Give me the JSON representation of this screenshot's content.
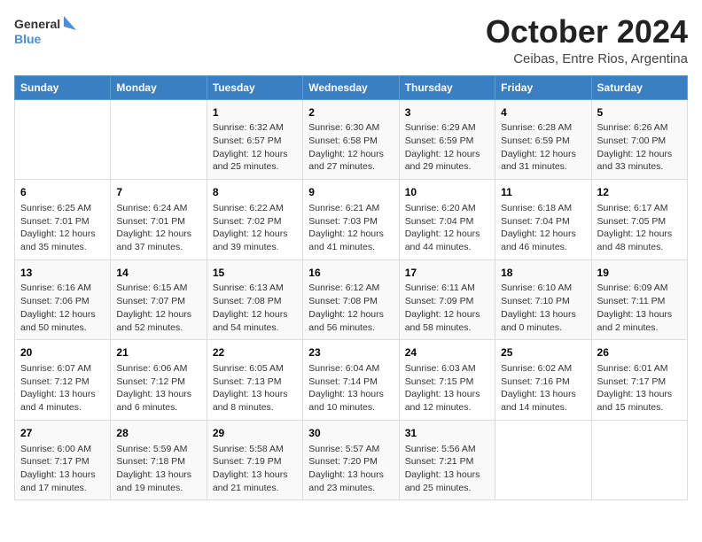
{
  "logo": {
    "general": "General",
    "blue": "Blue"
  },
  "title": "October 2024",
  "subtitle": "Ceibas, Entre Rios, Argentina",
  "days_header": [
    "Sunday",
    "Monday",
    "Tuesday",
    "Wednesday",
    "Thursday",
    "Friday",
    "Saturday"
  ],
  "weeks": [
    [
      {
        "day": "",
        "content": ""
      },
      {
        "day": "",
        "content": ""
      },
      {
        "day": "1",
        "content": "Sunrise: 6:32 AM\nSunset: 6:57 PM\nDaylight: 12 hours\nand 25 minutes."
      },
      {
        "day": "2",
        "content": "Sunrise: 6:30 AM\nSunset: 6:58 PM\nDaylight: 12 hours\nand 27 minutes."
      },
      {
        "day": "3",
        "content": "Sunrise: 6:29 AM\nSunset: 6:59 PM\nDaylight: 12 hours\nand 29 minutes."
      },
      {
        "day": "4",
        "content": "Sunrise: 6:28 AM\nSunset: 6:59 PM\nDaylight: 12 hours\nand 31 minutes."
      },
      {
        "day": "5",
        "content": "Sunrise: 6:26 AM\nSunset: 7:00 PM\nDaylight: 12 hours\nand 33 minutes."
      }
    ],
    [
      {
        "day": "6",
        "content": "Sunrise: 6:25 AM\nSunset: 7:01 PM\nDaylight: 12 hours\nand 35 minutes."
      },
      {
        "day": "7",
        "content": "Sunrise: 6:24 AM\nSunset: 7:01 PM\nDaylight: 12 hours\nand 37 minutes."
      },
      {
        "day": "8",
        "content": "Sunrise: 6:22 AM\nSunset: 7:02 PM\nDaylight: 12 hours\nand 39 minutes."
      },
      {
        "day": "9",
        "content": "Sunrise: 6:21 AM\nSunset: 7:03 PM\nDaylight: 12 hours\nand 41 minutes."
      },
      {
        "day": "10",
        "content": "Sunrise: 6:20 AM\nSunset: 7:04 PM\nDaylight: 12 hours\nand 44 minutes."
      },
      {
        "day": "11",
        "content": "Sunrise: 6:18 AM\nSunset: 7:04 PM\nDaylight: 12 hours\nand 46 minutes."
      },
      {
        "day": "12",
        "content": "Sunrise: 6:17 AM\nSunset: 7:05 PM\nDaylight: 12 hours\nand 48 minutes."
      }
    ],
    [
      {
        "day": "13",
        "content": "Sunrise: 6:16 AM\nSunset: 7:06 PM\nDaylight: 12 hours\nand 50 minutes."
      },
      {
        "day": "14",
        "content": "Sunrise: 6:15 AM\nSunset: 7:07 PM\nDaylight: 12 hours\nand 52 minutes."
      },
      {
        "day": "15",
        "content": "Sunrise: 6:13 AM\nSunset: 7:08 PM\nDaylight: 12 hours\nand 54 minutes."
      },
      {
        "day": "16",
        "content": "Sunrise: 6:12 AM\nSunset: 7:08 PM\nDaylight: 12 hours\nand 56 minutes."
      },
      {
        "day": "17",
        "content": "Sunrise: 6:11 AM\nSunset: 7:09 PM\nDaylight: 12 hours\nand 58 minutes."
      },
      {
        "day": "18",
        "content": "Sunrise: 6:10 AM\nSunset: 7:10 PM\nDaylight: 13 hours\nand 0 minutes."
      },
      {
        "day": "19",
        "content": "Sunrise: 6:09 AM\nSunset: 7:11 PM\nDaylight: 13 hours\nand 2 minutes."
      }
    ],
    [
      {
        "day": "20",
        "content": "Sunrise: 6:07 AM\nSunset: 7:12 PM\nDaylight: 13 hours\nand 4 minutes."
      },
      {
        "day": "21",
        "content": "Sunrise: 6:06 AM\nSunset: 7:12 PM\nDaylight: 13 hours\nand 6 minutes."
      },
      {
        "day": "22",
        "content": "Sunrise: 6:05 AM\nSunset: 7:13 PM\nDaylight: 13 hours\nand 8 minutes."
      },
      {
        "day": "23",
        "content": "Sunrise: 6:04 AM\nSunset: 7:14 PM\nDaylight: 13 hours\nand 10 minutes."
      },
      {
        "day": "24",
        "content": "Sunrise: 6:03 AM\nSunset: 7:15 PM\nDaylight: 13 hours\nand 12 minutes."
      },
      {
        "day": "25",
        "content": "Sunrise: 6:02 AM\nSunset: 7:16 PM\nDaylight: 13 hours\nand 14 minutes."
      },
      {
        "day": "26",
        "content": "Sunrise: 6:01 AM\nSunset: 7:17 PM\nDaylight: 13 hours\nand 15 minutes."
      }
    ],
    [
      {
        "day": "27",
        "content": "Sunrise: 6:00 AM\nSunset: 7:17 PM\nDaylight: 13 hours\nand 17 minutes."
      },
      {
        "day": "28",
        "content": "Sunrise: 5:59 AM\nSunset: 7:18 PM\nDaylight: 13 hours\nand 19 minutes."
      },
      {
        "day": "29",
        "content": "Sunrise: 5:58 AM\nSunset: 7:19 PM\nDaylight: 13 hours\nand 21 minutes."
      },
      {
        "day": "30",
        "content": "Sunrise: 5:57 AM\nSunset: 7:20 PM\nDaylight: 13 hours\nand 23 minutes."
      },
      {
        "day": "31",
        "content": "Sunrise: 5:56 AM\nSunset: 7:21 PM\nDaylight: 13 hours\nand 25 minutes."
      },
      {
        "day": "",
        "content": ""
      },
      {
        "day": "",
        "content": ""
      }
    ]
  ]
}
